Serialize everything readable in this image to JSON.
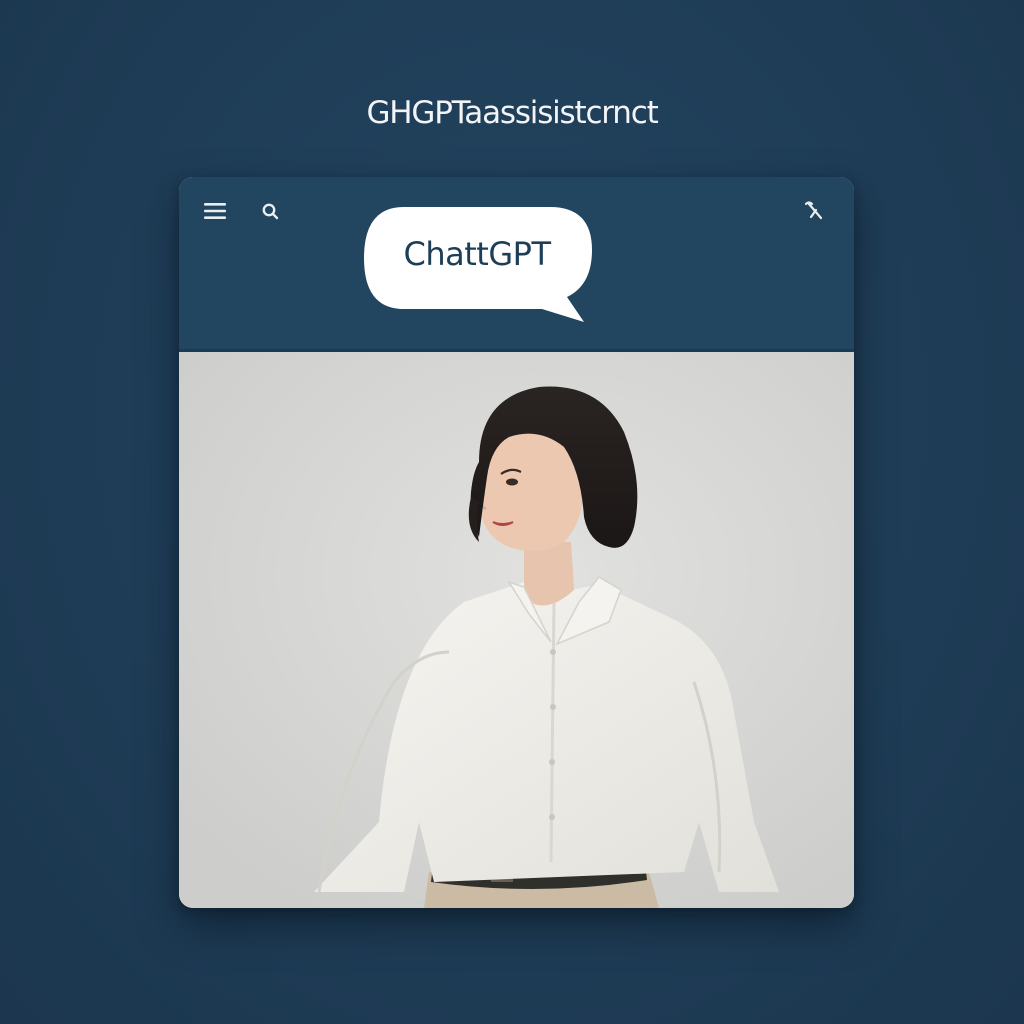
{
  "page": {
    "heading": "GHGPTaassisistcrnct"
  },
  "header": {
    "bubble_label": "ChattGPT",
    "icons": {
      "menu": "hamburger-menu-icon",
      "search": "search-icon",
      "tools": "tools-icon"
    }
  },
  "colors": {
    "background": "#1f3d57",
    "header": "#234660",
    "bubble": "#ffffff",
    "bubble_text": "#1d3e57",
    "photo_background": "#d6d6d4"
  }
}
